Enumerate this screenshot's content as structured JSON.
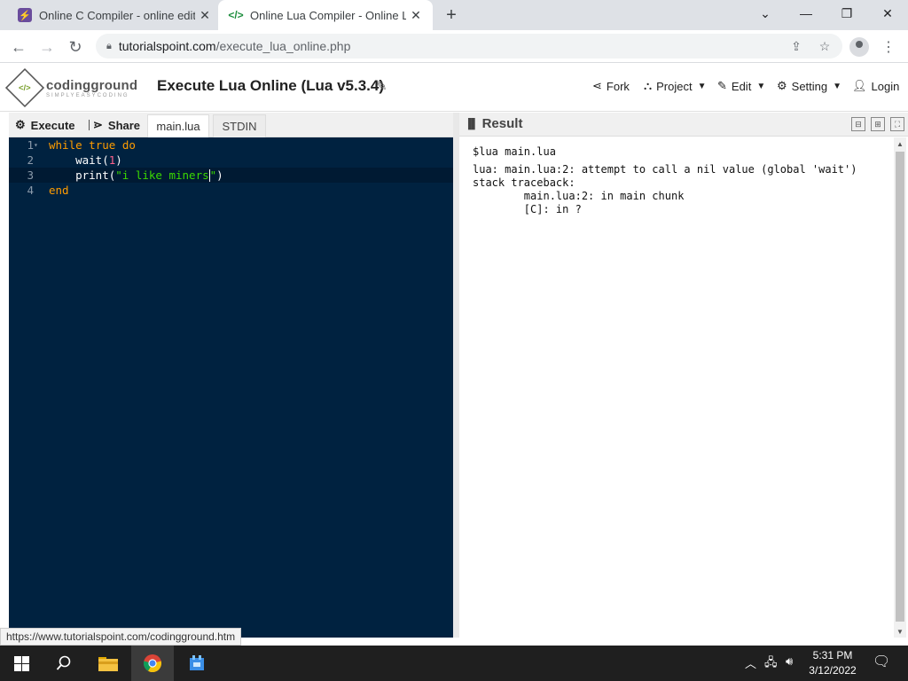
{
  "browser": {
    "tabs": [
      {
        "title": "Online C Compiler - online editor",
        "icon": "bolt-icon"
      },
      {
        "title": "Online Lua Compiler - Online Lua",
        "icon": "code-icon"
      }
    ],
    "url_host": "tutorialspoint.com",
    "url_path": "/execute_lua_online.php"
  },
  "site": {
    "logo_text": "codingground",
    "logo_tagline": "SIMPLYEASYCODING",
    "page_title": "Execute Lua Online (Lua v5.3.4)",
    "menu": {
      "fork": "Fork",
      "project": "Project",
      "edit": "Edit",
      "setting": "Setting",
      "login": "Login"
    }
  },
  "editor": {
    "execute_label": "Execute",
    "share_label": "Share",
    "file_tab": "main.lua",
    "stdin_tab": "STDIN",
    "line_numbers": [
      "1",
      "2",
      "3",
      "4"
    ],
    "tokens": {
      "l1_while": "while",
      "l1_true": "true",
      "l1_do": "do",
      "l2_fn": "wait(",
      "l2_num": "1",
      "l2_close": ")",
      "l3_fn": "print(",
      "l3_str": "\"i like miners",
      "l3_str_end": "\"",
      "l3_close": ")",
      "l4_end": "end"
    }
  },
  "result": {
    "title": "Result",
    "lines": [
      "$lua main.lua",
      "lua: main.lua:2: attempt to call a nil value (global 'wait')",
      "stack traceback:",
      "        main.lua:2: in main chunk",
      "        [C]: in ?"
    ]
  },
  "status_url": "https://www.tutorialspoint.com/codingground.htm",
  "taskbar": {
    "time": "5:31 PM",
    "date": "3/12/2022"
  }
}
